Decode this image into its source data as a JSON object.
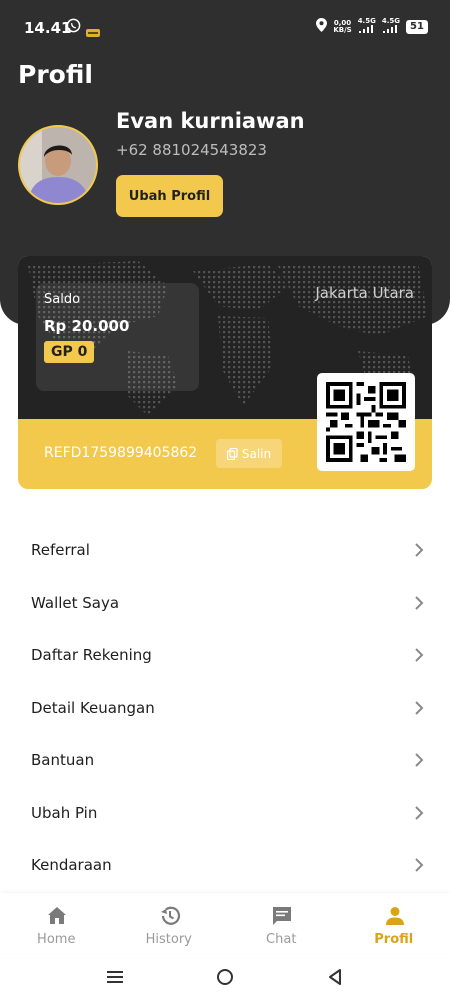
{
  "status_bar": {
    "time": "14.41",
    "net_speed_value": "0,00",
    "net_speed_unit": "KB/S",
    "sim1": "4.5G",
    "sim2": "4.5G",
    "battery": "51",
    "icons": [
      "whatsapp-icon",
      "gojek-app-icon",
      "location-icon",
      "signal-icon",
      "battery-icon"
    ]
  },
  "page": {
    "title": "Profil"
  },
  "profile": {
    "name": "Evan kurniawan",
    "phone": "+62 881024543823",
    "edit_button": "Ubah Profil"
  },
  "wallet_card": {
    "saldo_label": "Saldo",
    "saldo_value": "Rp 20.000",
    "gp_badge": "GP 0",
    "location": "Jakarta Utara",
    "referral_code": "REFD1759899405862",
    "copy_button": "Salin"
  },
  "menu": {
    "items": [
      {
        "label": "Referral"
      },
      {
        "label": "Wallet Saya"
      },
      {
        "label": "Daftar Rekening"
      },
      {
        "label": "Detail Keuangan"
      },
      {
        "label": "Bantuan"
      },
      {
        "label": "Ubah Pin"
      },
      {
        "label": "Kendaraan"
      }
    ]
  },
  "bottom_nav": {
    "items": [
      {
        "label": "Home",
        "icon": "home-icon"
      },
      {
        "label": "History",
        "icon": "history-icon"
      },
      {
        "label": "Chat",
        "icon": "chat-icon"
      },
      {
        "label": "Profil",
        "icon": "person-icon"
      }
    ],
    "active": "Profil"
  },
  "colors": {
    "header_bg": "#2f2f2f",
    "accent": "#f3c94d",
    "active_nav": "#d9a514",
    "card_dark": "#232323"
  }
}
